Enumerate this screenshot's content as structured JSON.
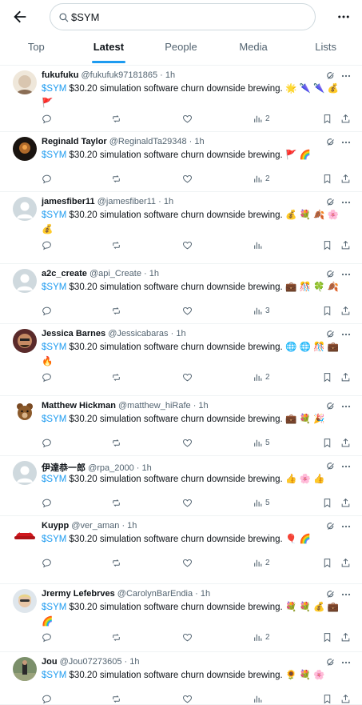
{
  "header": {
    "search_value": "$SYM",
    "tabs": [
      "Top",
      "Latest",
      "People",
      "Media",
      "Lists"
    ],
    "active_tab": "Latest"
  },
  "tweets": [
    {
      "name": "fukufuku",
      "handle": "@fukufuk97181865",
      "time": "1h",
      "cashtag": "$SYM",
      "text": " $30.20 simulation software churn downside brewing.",
      "emoji": "🌟 🌂 🌂 💰",
      "emoji2": "🚩",
      "views": "2",
      "avatar": "pale"
    },
    {
      "name": "Reginald Taylor",
      "handle": "@ReginaldTa29348",
      "time": "1h",
      "cashtag": "$SYM",
      "text": " $30.20 simulation software churn downside brewing.",
      "emoji": "🚩 🌈",
      "emoji2": "",
      "views": "2",
      "avatar": "dark"
    },
    {
      "name": "jamesfiber11",
      "handle": "@jamesfiber11",
      "time": "1h",
      "cashtag": "$SYM",
      "text": " $30.20 simulation software churn downside brewing.",
      "emoji": "💰 💐 🍂 🌸",
      "emoji2": "💰",
      "views": "",
      "avatar": "default"
    },
    {
      "name": "a2c_create",
      "handle": "@api_Create",
      "time": "1h",
      "cashtag": "$SYM",
      "text": " $30.20 simulation software churn downside brewing.",
      "emoji": "💼 🎊 🍀 🍂",
      "emoji2": "",
      "views": "3",
      "avatar": "default"
    },
    {
      "name": "Jessica Barnes",
      "handle": "@Jessicabaras",
      "time": "1h",
      "cashtag": "$SYM",
      "text": " $30.20 simulation software churn downside brewing.",
      "emoji": "🌐 🌐 🎊 💼",
      "emoji2": "🔥",
      "views": "2",
      "avatar": "face"
    },
    {
      "name": "Matthew Hickman",
      "handle": "@matthew_hiRafe",
      "time": "1h",
      "cashtag": "$SYM",
      "text": " $30.20 simulation software churn downside brewing.",
      "emoji": "💼 💐 🎉",
      "emoji2": "",
      "views": "5",
      "avatar": "bear"
    },
    {
      "name": "伊達恭一郎",
      "handle": "@rpa_2000",
      "time": "1h",
      "cashtag": "$SYM",
      "text": " $30.20 simulation software churn downside brewing.",
      "emoji": "👍 🌸 👍",
      "emoji2": "",
      "views": "5",
      "avatar": "default"
    },
    {
      "name": "Kuypp",
      "handle": "@ver_aman",
      "time": "1h",
      "cashtag": "$SYM",
      "text": " $30.20 simulation software churn downside brewing.",
      "emoji": "🎈 🌈",
      "emoji2": "",
      "views": "2",
      "avatar": "cap"
    },
    {
      "name": "Jrermy Lefebrves",
      "handle": "@CarolynBarEndia",
      "time": "1h",
      "cashtag": "$SYM",
      "text": " $30.20 simulation software churn downside brewing.",
      "emoji": "💐 💐 💰 💼",
      "emoji2": "🌈",
      "views": "2",
      "avatar": "blond"
    },
    {
      "name": "Jou",
      "handle": "@Jou07273605",
      "time": "1h",
      "cashtag": "$SYM",
      "text": " $30.20 simulation software churn downside brewing.",
      "emoji": "🌻 💐 🌸",
      "emoji2": "",
      "views": "",
      "avatar": "outdoor"
    }
  ],
  "colors": {
    "accent": "#1d9bf0",
    "text": "#0f1419",
    "muted": "#536471"
  }
}
